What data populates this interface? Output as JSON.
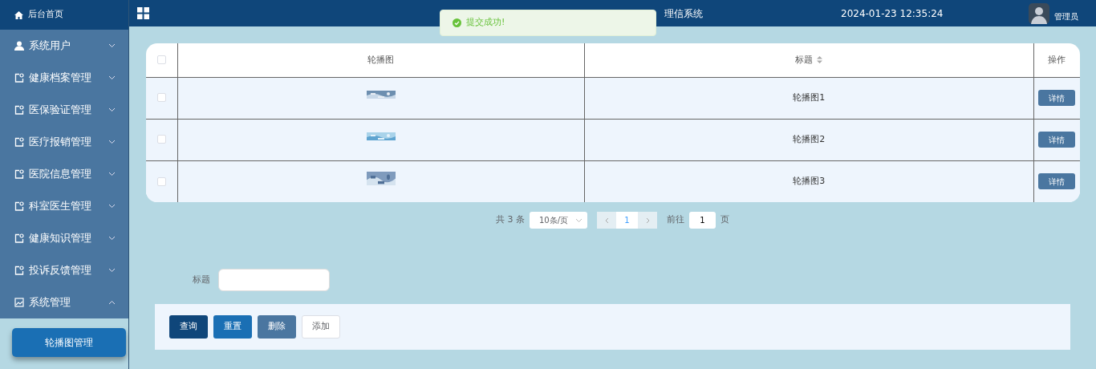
{
  "sidebar": {
    "home": "后台首页",
    "items": [
      {
        "label": "系统用户",
        "kind": "user",
        "expanded": false
      },
      {
        "label": "健康档案管理",
        "kind": "module",
        "expanded": false
      },
      {
        "label": "医保验证管理",
        "kind": "module",
        "expanded": false
      },
      {
        "label": "医疗报销管理",
        "kind": "module",
        "expanded": false
      },
      {
        "label": "医院信息管理",
        "kind": "module",
        "expanded": false
      },
      {
        "label": "科室医生管理",
        "kind": "module",
        "expanded": false
      },
      {
        "label": "健康知识管理",
        "kind": "module",
        "expanded": false
      },
      {
        "label": "投诉反馈管理",
        "kind": "module",
        "expanded": false
      },
      {
        "label": "系统管理",
        "kind": "system",
        "expanded": true,
        "children": [
          {
            "label": "轮播图管理",
            "selected": true
          }
        ]
      }
    ]
  },
  "header": {
    "title": "理信系统",
    "datetime": "2024-01-23 12:35:24",
    "user": "管理员"
  },
  "toast": {
    "message": "提交成功!"
  },
  "table": {
    "select_all_checked": false,
    "columns": [
      {
        "label": "轮播图",
        "sortable": false
      },
      {
        "label": "标题",
        "sortable": true
      },
      {
        "label": "操作",
        "sortable": false
      }
    ],
    "rows": [
      {
        "checked": false,
        "title": "轮播图1",
        "action": "详情"
      },
      {
        "checked": false,
        "title": "轮播图2",
        "action": "详情"
      },
      {
        "checked": false,
        "title": "轮播图3",
        "action": "详情"
      }
    ]
  },
  "pagination": {
    "total": "共 3 条",
    "page_size": "10条/页",
    "pages": [
      {
        "label": "1",
        "selected": true
      }
    ],
    "goto_label": "前往",
    "goto_value": "1",
    "goto_suffix": "页"
  },
  "search": {
    "label": "标题"
  },
  "buttons": [
    {
      "label": "查询",
      "kind": "query"
    },
    {
      "label": "重置",
      "kind": "reset"
    },
    {
      "label": "删除",
      "kind": "delete"
    },
    {
      "label": "添加",
      "kind": "add"
    }
  ]
}
